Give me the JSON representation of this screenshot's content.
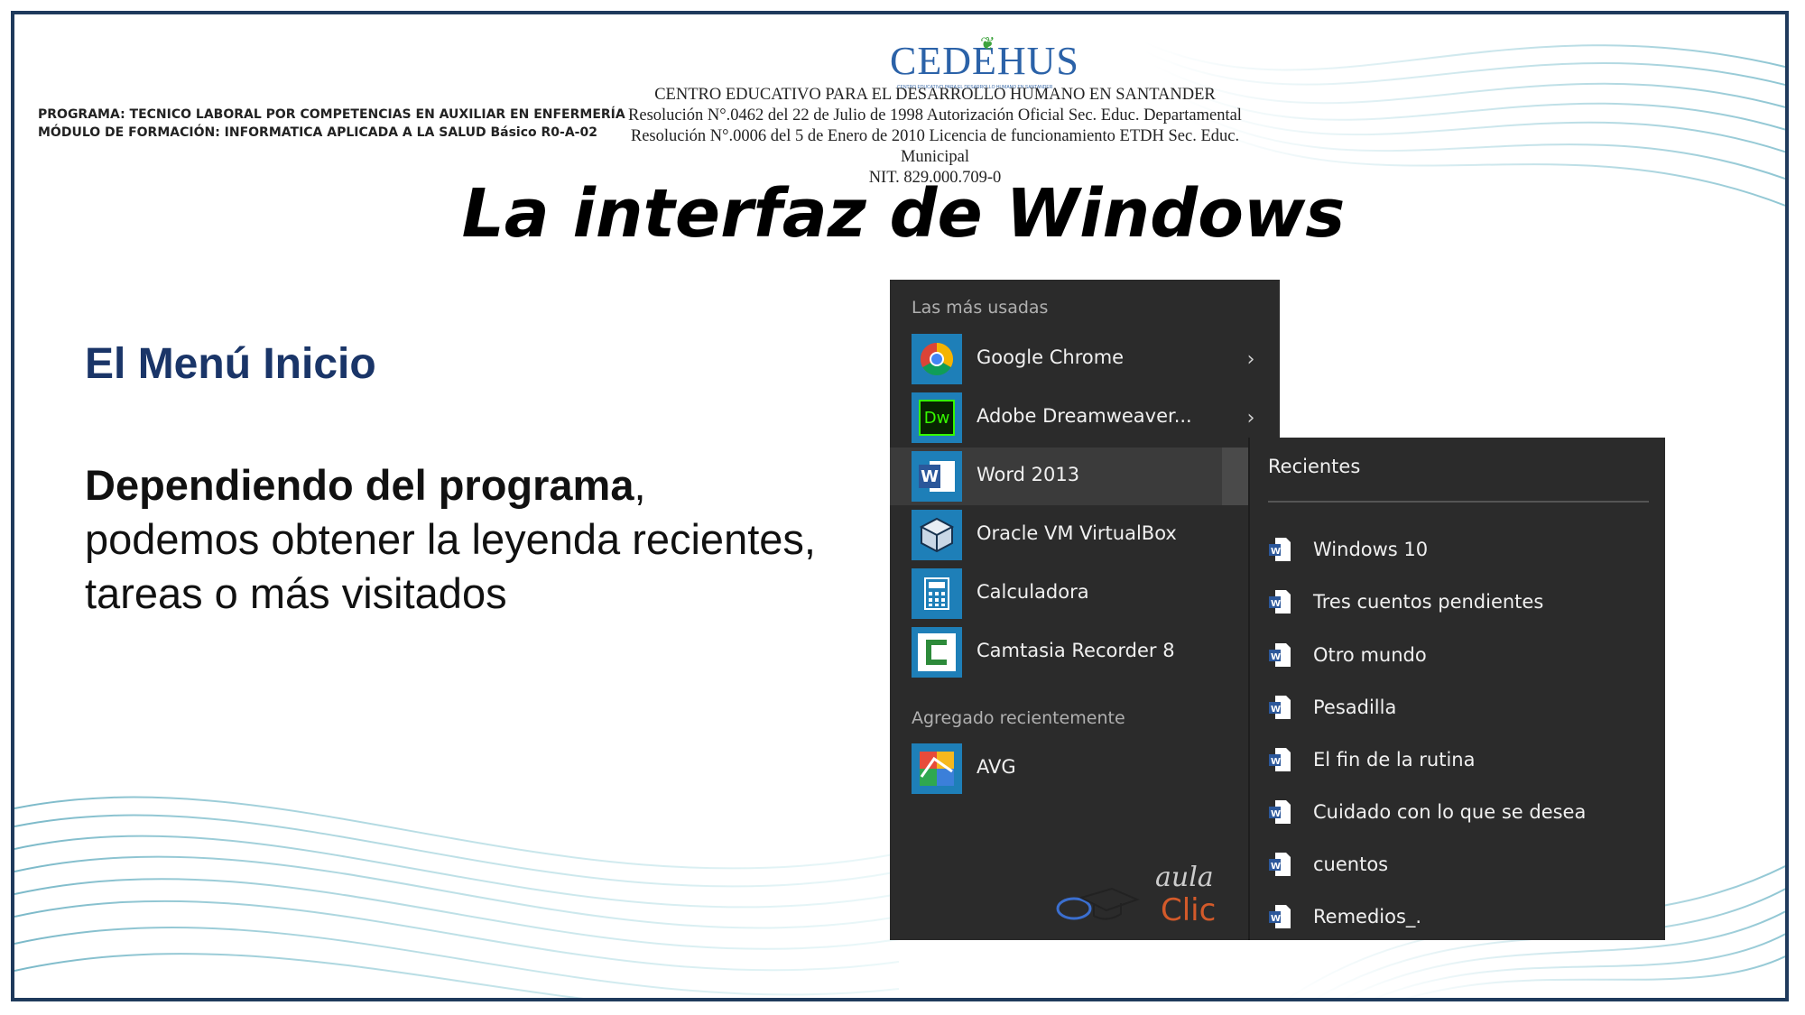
{
  "header": {
    "program_line1": "PROGRAMA: TECNICO LABORAL POR COMPETENCIAS EN AUXILIAR EN ENFERMERÍA",
    "program_line2": "MÓDULO DE FORMACIÓN: INFORMATICA APLICADA A LA SALUD Básico R0-A-02",
    "logo_text": "CEDEHUS",
    "logo_subtext": "CENTRO EDUCATIVO PARA EL DESARROLLO HUMANO EN SANTANDER",
    "institution_name": "CENTRO EDUCATIVO PARA EL DESARROLLO HUMANO EN SANTANDER",
    "resolution1": "Resolución  N°.0462 del 22 de Julio de 1998  Autorización Oficial Sec. Educ. Departamental",
    "resolution2": "Resolución N°.0006 del 5 de Enero de 2010 Licencia de funcionamiento ETDH Sec. Educ. Municipal",
    "nit": "NIT. 829.000.709-0"
  },
  "slide": {
    "title": "La interfaz de Windows",
    "subtitle": "El Menú Inicio",
    "body_bold": "Dependiendo del programa",
    "body_rest1": ",",
    "body_line2": "podemos obtener la leyenda recientes,",
    "body_line3": "tareas o más visitados"
  },
  "start_menu": {
    "most_used_header": "Las más usadas",
    "apps": [
      {
        "label": "Google Chrome",
        "icon": "chrome-icon",
        "has_arrow": true
      },
      {
        "label": "Adobe Dreamweaver...",
        "icon": "dreamweaver-icon",
        "has_arrow": true
      },
      {
        "label": "Word 2013",
        "icon": "word-icon",
        "has_arrow": true,
        "highlighted": true
      },
      {
        "label": "Oracle VM VirtualBox",
        "icon": "virtualbox-icon",
        "has_arrow": false
      },
      {
        "label": "Calculadora",
        "icon": "calculator-icon",
        "has_arrow": false
      },
      {
        "label": "Camtasia Recorder 8",
        "icon": "camtasia-icon",
        "has_arrow": true
      }
    ],
    "recent_header": "Agregado recientemente",
    "recent_apps": [
      {
        "label": "AVG",
        "icon": "avg-icon"
      }
    ],
    "arrow_glyph": "›",
    "icon_glyphs": {
      "dw": "Dw",
      "word": "W"
    }
  },
  "jumplist": {
    "header": "Recientes",
    "items": [
      "Windows 10",
      "Tres cuentos pendientes",
      "Otro mundo",
      "Pesadilla",
      "El fin de la rutina",
      "Cuidado con lo que se desea",
      "cuentos",
      "Remedios_."
    ]
  },
  "watermark": {
    "line1": "aula",
    "line2": "Clic"
  },
  "colors": {
    "menu_bg": "#2b2b2b",
    "tile_blue": "#1e7fb8",
    "title_blue": "#1a3568",
    "frame": "#1f3a5c"
  }
}
